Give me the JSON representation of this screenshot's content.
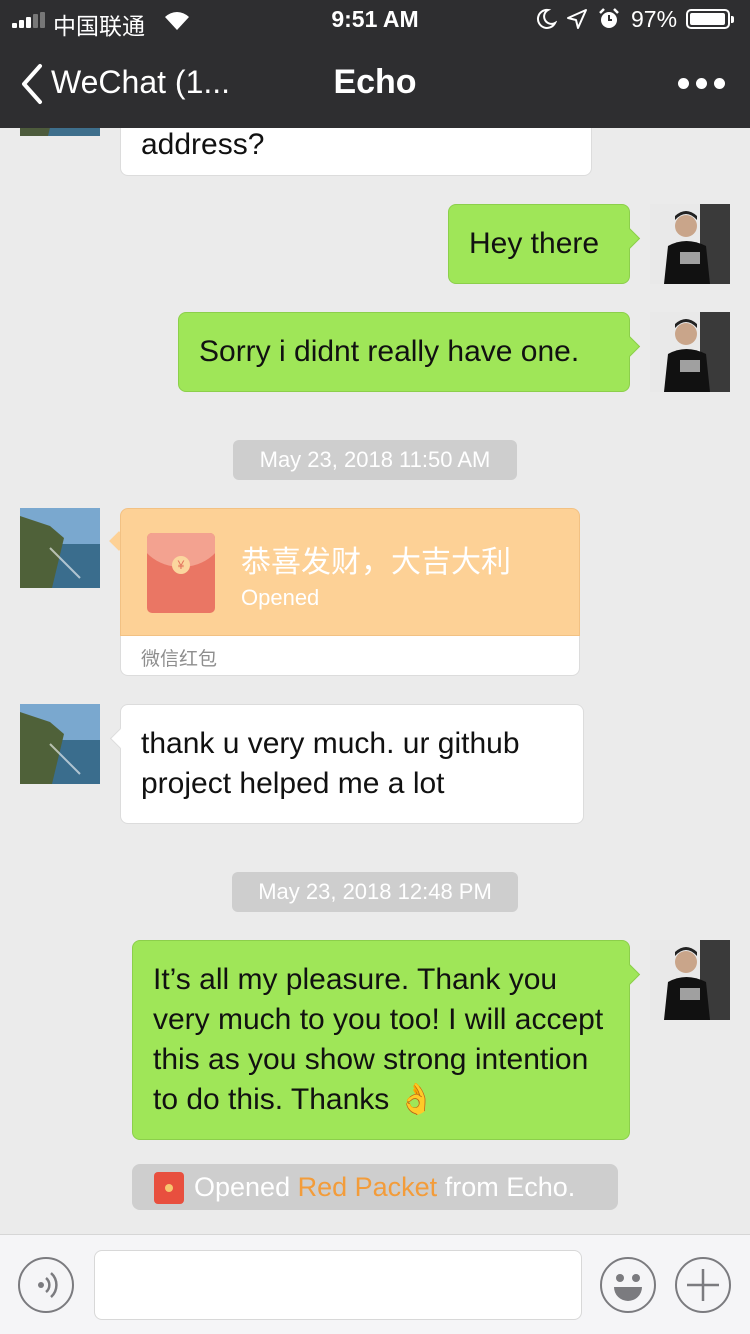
{
  "status_bar": {
    "carrier": "中国联通",
    "time": "9:51 AM",
    "battery_percent": "97%",
    "battery_level": 0.97
  },
  "nav": {
    "back_label": "WeChat (1...",
    "title": "Echo"
  },
  "messages": [
    {
      "side": "in",
      "text": "address?"
    },
    {
      "side": "out",
      "text": "Hey there"
    },
    {
      "side": "out",
      "text": "Sorry i didnt really have one."
    },
    {
      "side": "in",
      "text": "thank u very much. ur github project helped me a lot"
    },
    {
      "side": "out",
      "text": "It’s all my pleasure. Thank you very much to you too! I will accept this as you show strong intention to do this. Thanks 👌"
    }
  ],
  "timestamps": [
    "May 23, 2018 11:50 AM",
    "May 23, 2018 12:48 PM"
  ],
  "red_packet": {
    "title": "恭喜发财，大吉大利",
    "status": "Opened",
    "label": "微信红包"
  },
  "system_message": {
    "prefix": "Opened",
    "highlight": "Red Packet",
    "suffix": "from Echo."
  },
  "input_bar": {
    "placeholder": ""
  },
  "colors": {
    "nav_bg": "#2e2e30",
    "chat_bg": "#ebebeb",
    "outgoing_bubble": "#9fe658",
    "incoming_bubble": "#ffffff",
    "red_packet": "#fdd196",
    "highlight": "#f39c3a"
  }
}
